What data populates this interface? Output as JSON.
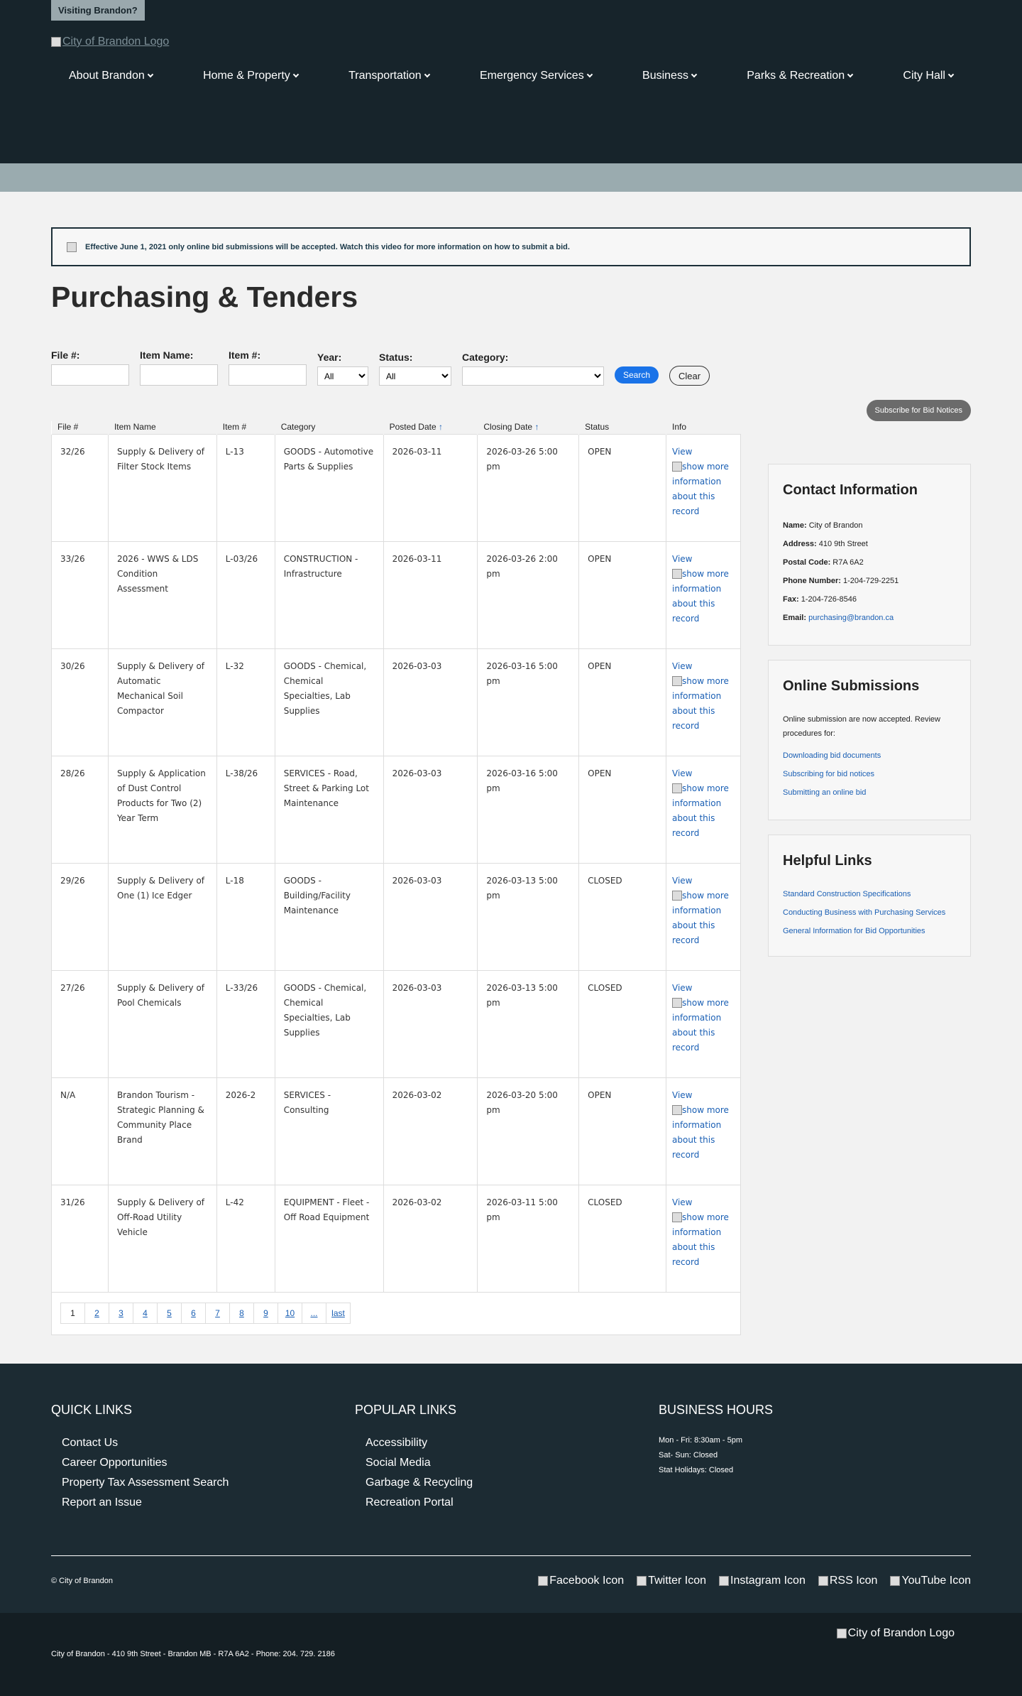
{
  "header": {
    "visiting": "Visiting Brandon?",
    "logo_alt": "City of Brandon Logo",
    "nav": [
      "About Brandon",
      "Home & Property",
      "Transportation",
      "Emergency Services",
      "Business",
      "Parks & Recreation",
      "City Hall"
    ]
  },
  "notice": {
    "text_before": "Effective June 1, 2021 only online bid submissions will be accepted. Watch this",
    "link": "video",
    "text_after": "for more information on how to submit a bid."
  },
  "page_title": "Purchasing & Tenders",
  "filters": {
    "file_label": "File #:",
    "item_name_label": "Item Name:",
    "item_no_label": "Item #:",
    "year_label": "Year:",
    "year_value": "All",
    "status_label": "Status:",
    "status_value": "All",
    "category_label": "Category:",
    "category_value": "",
    "search": "Search",
    "clear": "Clear"
  },
  "subscribe": "Subscribe for Bid Notices",
  "table": {
    "headers": [
      "File #",
      "Item Name",
      "Item #",
      "Category",
      "Posted Date",
      "Closing Date",
      "Status",
      "Info"
    ],
    "sort_arrow": "↑",
    "view_label": "View",
    "more_alt": "show more information about this record",
    "rows": [
      {
        "file": "32/26",
        "name": "Supply & Delivery of Filter Stock Items",
        "item": "L-13",
        "category": "GOODS - Automotive Parts & Supplies",
        "posted": "2026-03-11",
        "closing": "2026-03-26 5:00 pm",
        "status": "OPEN"
      },
      {
        "file": "33/26",
        "name": "2026 - WWS & LDS Condition Assessment",
        "item": "L-03/26",
        "category": "CONSTRUCTION - Infrastructure",
        "posted": "2026-03-11",
        "closing": "2026-03-26 2:00 pm",
        "status": "OPEN"
      },
      {
        "file": "30/26",
        "name": "Supply & Delivery of Automatic Mechanical Soil Compactor",
        "item": "L-32",
        "category": "GOODS - Chemical, Chemical Specialties, Lab Supplies",
        "posted": "2026-03-03",
        "closing": "2026-03-16 5:00 pm",
        "status": "OPEN"
      },
      {
        "file": "28/26",
        "name": "Supply & Application of Dust Control Products for Two (2) Year Term",
        "item": "L-38/26",
        "category": "SERVICES - Road, Street & Parking Lot Maintenance",
        "posted": "2026-03-03",
        "closing": "2026-03-16 5:00 pm",
        "status": "OPEN"
      },
      {
        "file": "29/26",
        "name": "Supply & Delivery of One (1) Ice Edger",
        "item": "L-18",
        "category": "GOODS - Building/Facility Maintenance",
        "posted": "2026-03-03",
        "closing": "2026-03-13 5:00 pm",
        "status": "CLOSED"
      },
      {
        "file": "27/26",
        "name": "Supply & Delivery of Pool Chemicals",
        "item": "L-33/26",
        "category": "GOODS - Chemical, Chemical Specialties, Lab Supplies",
        "posted": "2026-03-03",
        "closing": "2026-03-13 5:00 pm",
        "status": "CLOSED"
      },
      {
        "file": "N/A",
        "name": "Brandon Tourism - Strategic Planning & Community Place Brand",
        "item": "2026-2",
        "category": "SERVICES - Consulting",
        "posted": "2026-03-02",
        "closing": "2026-03-20 5:00 pm",
        "status": "OPEN"
      },
      {
        "file": "31/26",
        "name": "Supply & Delivery of Off-Road Utility Vehicle",
        "item": "L-42",
        "category": "EQUIPMENT - Fleet - Off Road Equipment",
        "posted": "2026-03-02",
        "closing": "2026-03-11 5:00 pm",
        "status": "CLOSED"
      }
    ]
  },
  "pager": [
    "1",
    "2",
    "3",
    "4",
    "5",
    "6",
    "7",
    "8",
    "9",
    "10",
    "...",
    "last"
  ],
  "contact": {
    "title": "Contact Information",
    "name_label": "Name:",
    "name": "City of Brandon",
    "address_label": "Address:",
    "address": "410 9th Street",
    "postal_label": "Postal Code:",
    "postal": "R7A 6A2",
    "phone_label": "Phone Number:",
    "phone": "1-204-729-2251",
    "fax_label": "Fax:",
    "fax": "1-204-726-8546",
    "email_label": "Email:",
    "email": "purchasing@brandon.ca"
  },
  "online": {
    "title": "Online Submissions",
    "intro": "Online submission are now accepted. Review procedures for:",
    "links": [
      "Downloading bid documents",
      "Subscribing for bid notices",
      "Submitting an online bid"
    ]
  },
  "helpful": {
    "title": "Helpful Links",
    "links": [
      "Standard Construction Specifications",
      "Conducting Business with Purchasing Services",
      "General Information for Bid Opportunities"
    ]
  },
  "footer": {
    "quick_title": "QUICK LINKS",
    "quick": [
      "Contact Us",
      "Career Opportunities",
      "Property Tax Assessment Search",
      "Report an Issue"
    ],
    "popular_title": "POPULAR LINKS",
    "popular": [
      "Accessibility",
      "Social Media",
      "Garbage & Recycling",
      "Recreation Portal"
    ],
    "hours_title": "BUSINESS HOURS",
    "hours": [
      "Mon - Fri: 8:30am - 5pm",
      "Sat- Sun: Closed",
      "Stat Holidays: Closed"
    ],
    "copy_symbol": "©",
    "copy_link": "City of Brandon",
    "social": [
      "Facebook Icon",
      "Twitter Icon",
      "Instagram Icon",
      "RSS Icon",
      "YouTube Icon"
    ],
    "logo_alt": "City of Brandon Logo",
    "address": "City of Brandon - 410 9th Street - Brandon MB - R7A 6A2 - Phone: 204. 729. 2186"
  }
}
